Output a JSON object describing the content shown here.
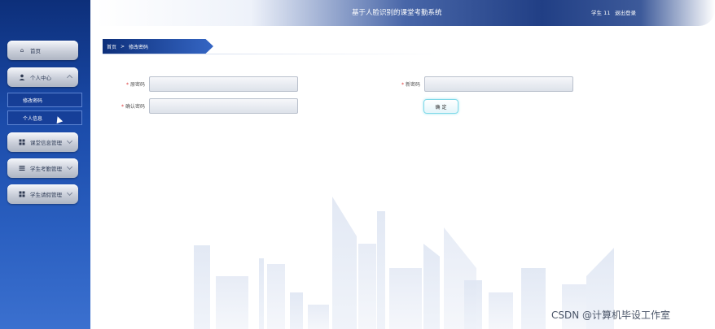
{
  "header": {
    "title": "基于人脸识别的课堂考勤系统",
    "user": "学生 11",
    "logout": "退出登录"
  },
  "sidebar": {
    "items": [
      {
        "label": "首页",
        "icon": "home-icon"
      },
      {
        "label": "个人中心",
        "icon": "user-icon"
      },
      {
        "label": "课堂信息管理",
        "icon": "grid-icon"
      },
      {
        "label": "学生考勤管理",
        "icon": "list-icon"
      },
      {
        "label": "学生请假管理",
        "icon": "grid-icon"
      }
    ],
    "sub_items": [
      {
        "label": "修改密码"
      },
      {
        "label": "个人信息"
      }
    ]
  },
  "breadcrumb": {
    "home": "首页",
    "separator": ">",
    "current": "修改密码"
  },
  "form": {
    "old_password": {
      "label": "原密码",
      "value": ""
    },
    "new_password": {
      "label": "新密码",
      "value": ""
    },
    "confirm_password": {
      "label": "确认密码",
      "value": ""
    },
    "required_mark": "*",
    "submit_label": "确 定"
  },
  "watermark": "CSDN @计算机毕设工作室",
  "colors": {
    "sidebar": "#1a4aa8",
    "header_dark": "#213f85",
    "accent_cyan": "#7fd9e8"
  }
}
